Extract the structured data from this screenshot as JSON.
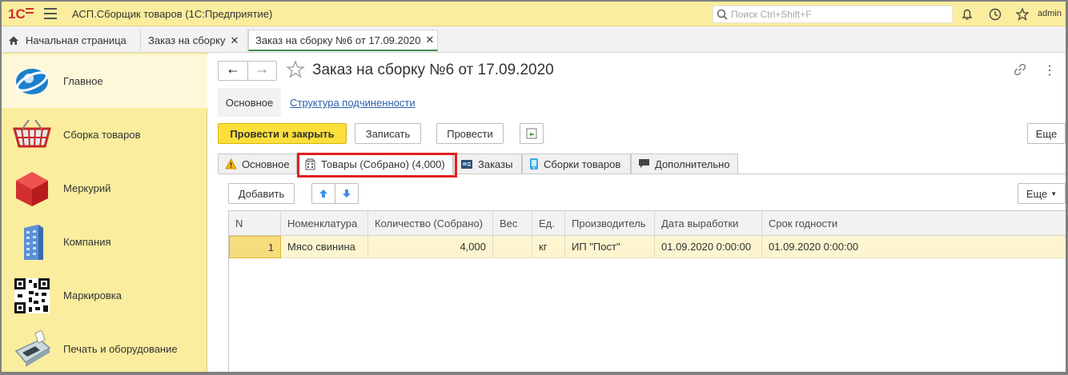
{
  "app": {
    "title": "АСП.Сборщик товаров  (1С:Предприятие)",
    "user": "admin",
    "search_placeholder": "Поиск Ctrl+Shift+F"
  },
  "open_tabs": [
    {
      "label": "Начальная страница"
    },
    {
      "label": "Заказ на сборку"
    },
    {
      "label": "Заказ на сборку №6 от 17.09.2020"
    }
  ],
  "sidebar": {
    "items": [
      {
        "label": "Главное",
        "icon": "globe-icon"
      },
      {
        "label": "Сборка товаров",
        "icon": "basket-icon"
      },
      {
        "label": "Меркурий",
        "icon": "red-cube-icon"
      },
      {
        "label": "Компания",
        "icon": "building-icon"
      },
      {
        "label": "Маркировка",
        "icon": "qr-code-icon"
      },
      {
        "label": "Печать и оборудование",
        "icon": "payment-terminal-icon"
      }
    ]
  },
  "document": {
    "title": "Заказ на сборку №6 от 17.09.2020",
    "subnav": {
      "active": "Основное",
      "link": "Структура подчиненности"
    }
  },
  "toolbar": {
    "post_close": "Провести и закрыть",
    "write": "Записать",
    "post": "Провести",
    "more": "Еще"
  },
  "form_tabs": [
    {
      "label": "Основное",
      "icon": "warning-icon"
    },
    {
      "label": "Товары (Собрано) (4,000)",
      "icon": "building-icon"
    },
    {
      "label": "Заказы",
      "icon": "card-icon"
    },
    {
      "label": "Сборки товаров",
      "icon": "phone-icon"
    },
    {
      "label": "Дополнительно",
      "icon": "speech-icon"
    }
  ],
  "table_toolbar": {
    "add": "Добавить",
    "more": "Еще"
  },
  "table": {
    "columns": [
      "N",
      "Номенклатура",
      "Количество (Собрано)",
      "Вес",
      "Ед.",
      "Производитель",
      "Дата выработки",
      "Срок годности"
    ],
    "rows": [
      {
        "n": "1",
        "name": "Мясо свинина",
        "qty": "4,000",
        "weight": "",
        "unit": "кг",
        "maker": "ИП \"Пост\"",
        "made": "01.09.2020 0:00:00",
        "expiry": "01.09.2020 0:00:00"
      }
    ]
  },
  "colors": {
    "topbar": "#fbed9e",
    "primary_button": "#fcdf3a",
    "highlight_box": "#e02020",
    "link": "#2b5fa8"
  }
}
